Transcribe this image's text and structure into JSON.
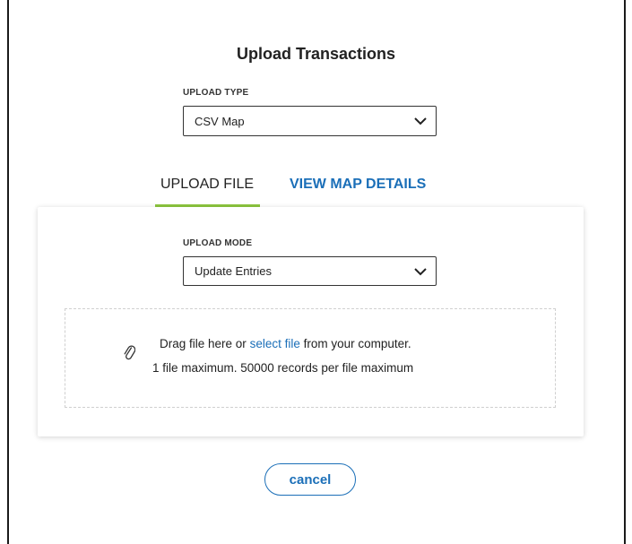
{
  "dialog": {
    "title": "Upload Transactions"
  },
  "upload_type": {
    "label": "UPLOAD TYPE",
    "value": "CSV Map"
  },
  "tabs": [
    {
      "label": "UPLOAD FILE",
      "active": true
    },
    {
      "label": "VIEW MAP DETAILS",
      "active": false
    }
  ],
  "upload_mode": {
    "label": "UPLOAD MODE",
    "value": "Update Entries"
  },
  "dropzone": {
    "text_before": "Drag file here or",
    "link": "select file",
    "text_after": "from your computer.",
    "limits": "1 file maximum. 50000 records per file maximum"
  },
  "actions": {
    "cancel_label": "cancel"
  },
  "colors": {
    "accent": "#1b6fb8",
    "tab_indicator": "#8cc63f",
    "border": "#333333"
  },
  "icons": {
    "select_arrow": "chevron-down-icon",
    "attachment": "paperclip-icon"
  }
}
